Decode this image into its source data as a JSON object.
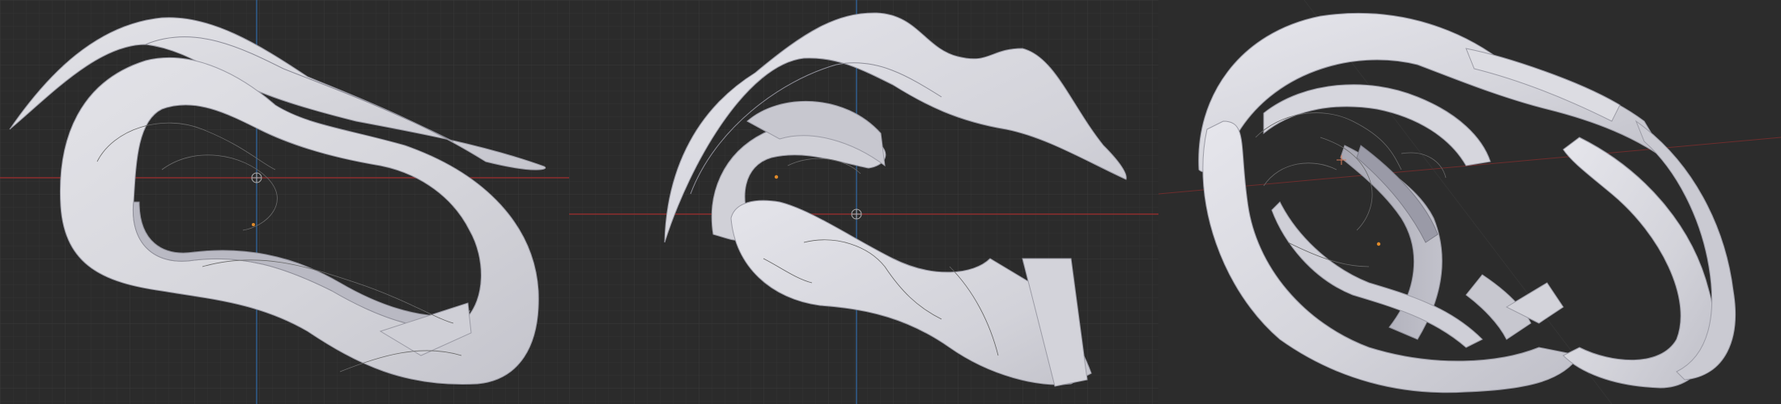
{
  "app": {
    "type": "3d-viewport-screenshot",
    "background_color": "#2b2b2b"
  },
  "viewports": [
    {
      "id": "top",
      "view": "orthographic-top",
      "grid": true,
      "x_axis_color": "#a33a3a",
      "y_axis_color": "#3a6aa3",
      "shows_origin_marker": true
    },
    {
      "id": "front",
      "view": "orthographic-front",
      "grid": true,
      "x_axis_color": "#a33a3a",
      "z_axis_color": "#3a6aa3",
      "shows_origin_marker": true
    },
    {
      "id": "perspective",
      "view": "perspective",
      "grid": false,
      "x_axis_color": "#a33a3a",
      "shows_origin_marker": false
    }
  ],
  "object": {
    "name": "curved-ribbon-sculpture",
    "surface_color": "#d6d6dc",
    "shadow_color": "#a9a9b4",
    "wire_color": "#5a5a5a",
    "pivot_color": "#e08a2a"
  }
}
